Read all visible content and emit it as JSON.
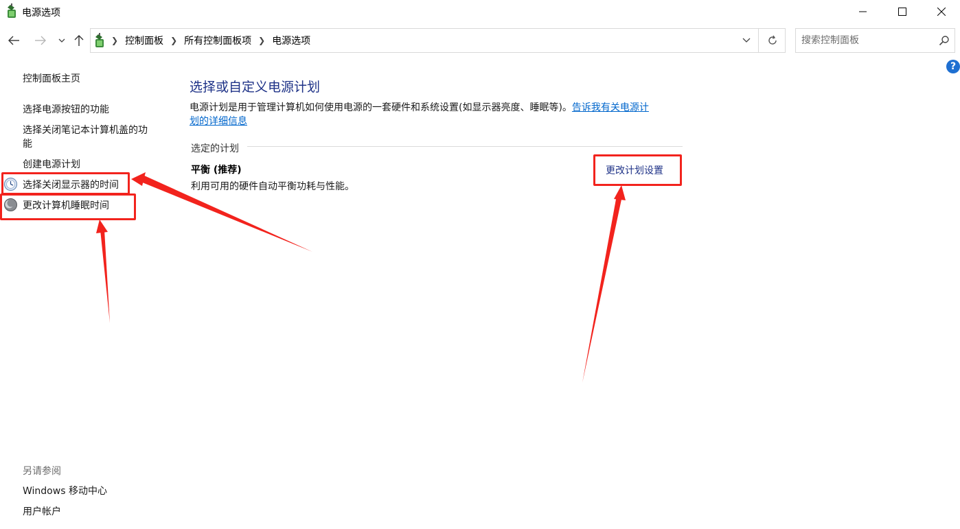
{
  "window": {
    "title": "电源选项"
  },
  "breadcrumb": {
    "items": [
      "控制面板",
      "所有控制面板项",
      "电源选项"
    ]
  },
  "search": {
    "placeholder": "搜索控制面板"
  },
  "help": {
    "label": "?"
  },
  "sidebar": {
    "home": "控制面板主页",
    "items": [
      "选择电源按钮的功能",
      "选择关闭笔记本计算机盖的功",
      "能",
      "创建电源计划",
      "选择关闭显示器的时间",
      "更改计算机睡眠时间"
    ],
    "see_also_title": "另请参阅",
    "see_also": [
      "Windows 移动中心",
      "用户帐户"
    ]
  },
  "main": {
    "title": "选择或自定义电源计划",
    "description_line1": "电源计划是用于管理计算机如何使用电源的一套硬件和系统设置(如显示器亮度、睡眠等)。",
    "description_link1": "告诉我有关电源计",
    "description_link2": "划的详细信息",
    "section_label": "选定的计划",
    "plan": {
      "name": "平衡 (推荐)",
      "description": "利用可用的硬件自动平衡功耗与性能。",
      "change_link": "更改计划设置"
    }
  },
  "colors": {
    "title_blue": "#1e3287",
    "link_blue": "#0066cc",
    "annotation_red": "#f2231d"
  }
}
